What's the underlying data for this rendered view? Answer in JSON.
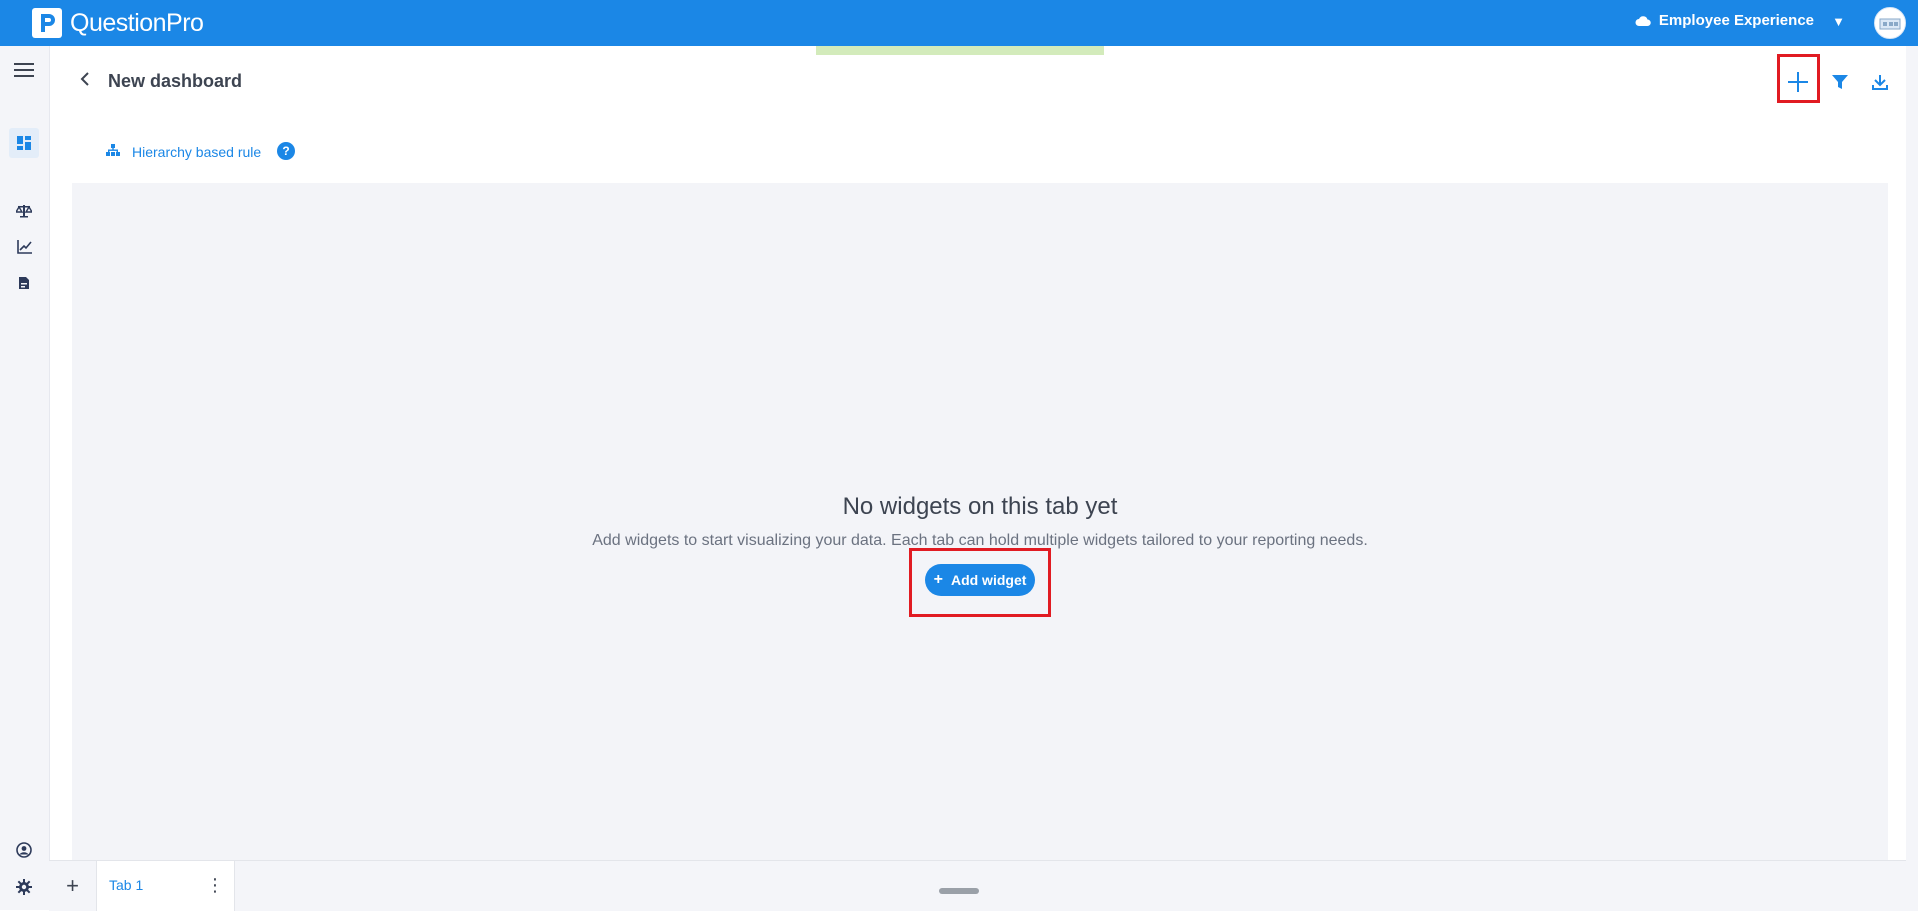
{
  "topbar": {
    "logo_text": "QuestionPro",
    "product": "Employee Experience",
    "caret": "▼"
  },
  "header": {
    "title": "New dashboard",
    "hierarchy_label": "Hierarchy based rule",
    "help_symbol": "?"
  },
  "empty_state": {
    "title": "No widgets on this tab yet",
    "description": "Add widgets to start visualizing your data. Each tab can hold multiple widgets tailored to your reporting needs.",
    "button_label": "Add widget",
    "button_symbol": "+"
  },
  "tabs": {
    "add_symbol": "+",
    "items": [
      {
        "label": "Tab 1",
        "menu_symbol": "⋮"
      }
    ]
  },
  "colors": {
    "brand": "#1b87e6",
    "highlight": "#e11b22",
    "canvas_bg": "#f3f4f8"
  }
}
